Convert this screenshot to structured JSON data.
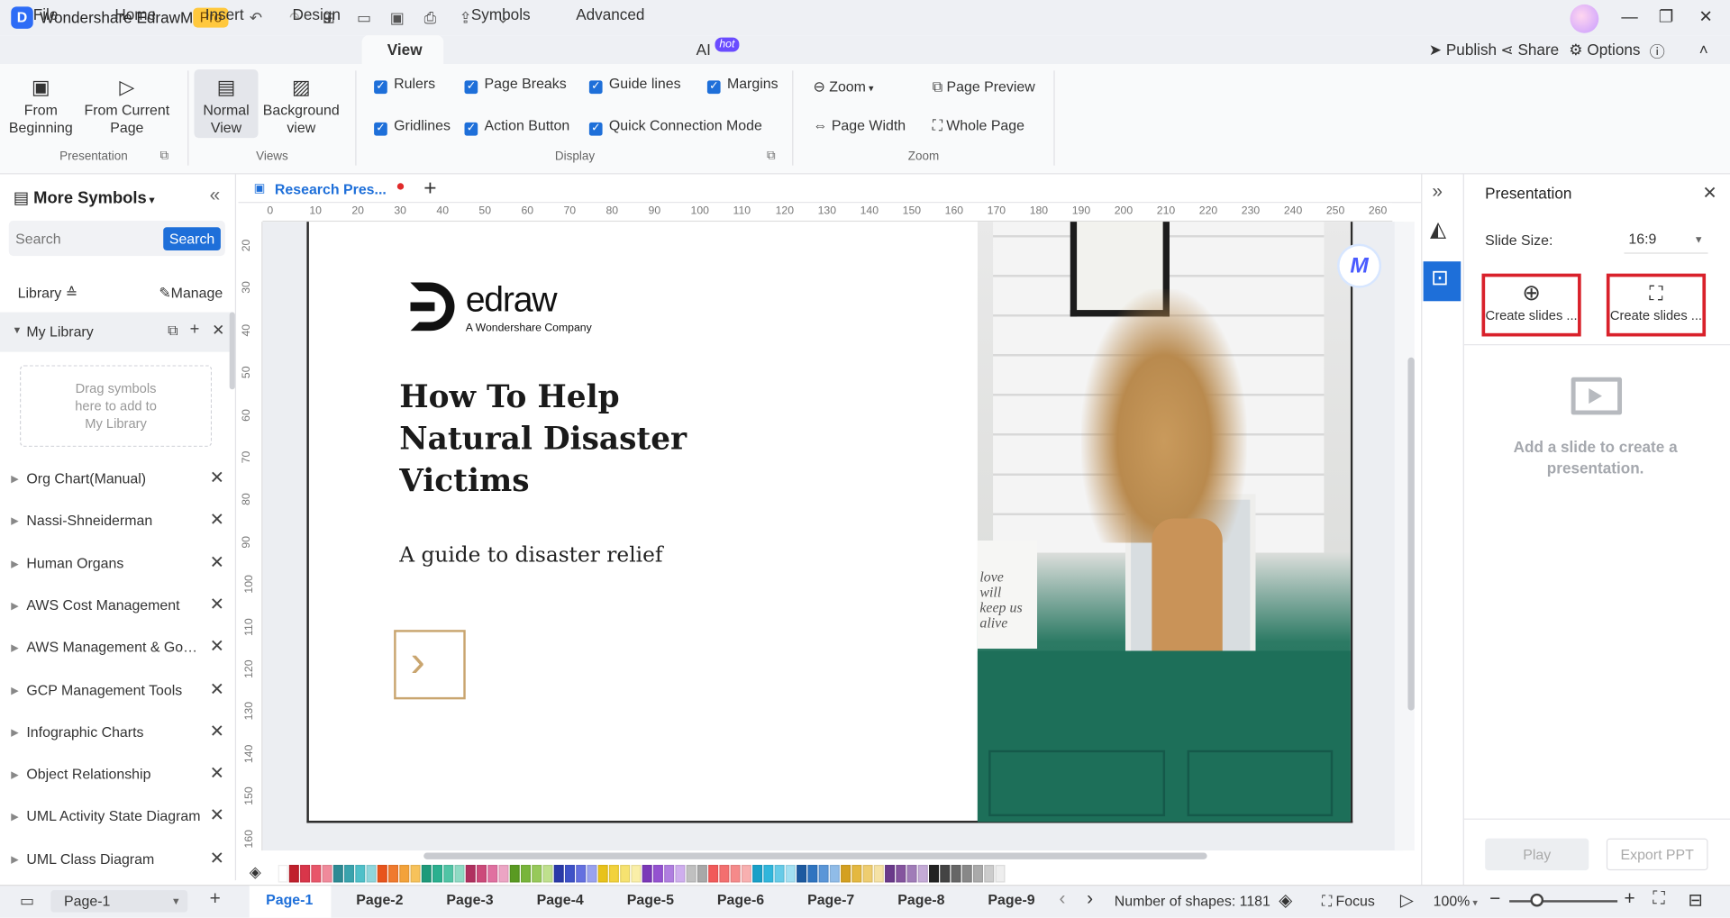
{
  "app": {
    "title": "Wondershare EdrawMax",
    "badge": "Pro"
  },
  "menu": {
    "items": [
      "File",
      "Home",
      "Insert",
      "Design",
      "View",
      "Symbols",
      "Advanced",
      "AI"
    ],
    "ai_badge": "hot",
    "right": {
      "publish": "Publish",
      "share": "Share",
      "options": "Options"
    }
  },
  "ribbon": {
    "presentation": {
      "from_beginning": "From\nBeginning",
      "from_current": "From Current\nPage",
      "group": "Presentation"
    },
    "views": {
      "normal": "Normal\nView",
      "background": "Background\nview",
      "group": "Views"
    },
    "display": {
      "rulers": "Rulers",
      "page_breaks": "Page Breaks",
      "guide_lines": "Guide lines",
      "margins": "Margins",
      "gridlines": "Gridlines",
      "action_button": "Action Button",
      "quick_connection": "Quick Connection Mode",
      "group": "Display"
    },
    "zoom": {
      "zoom": "Zoom",
      "page_preview": "Page Preview",
      "page_width": "Page Width",
      "whole_page": "Whole Page",
      "group": "Zoom"
    }
  },
  "sidebar": {
    "title": "More Symbols",
    "search_placeholder": "Search",
    "search_button": "Search",
    "library": "Library",
    "manage": "Manage",
    "my_library": "My Library",
    "drop_hint": "Drag symbols\nhere to add to\nMy Library",
    "libraries": [
      "Org Chart(Manual)",
      "Nassi-Shneiderman",
      "Human Organs",
      "AWS Cost Management",
      "AWS Management & Gove...",
      "GCP Management Tools",
      "Infographic Charts",
      "Object Relationship",
      "UML Activity State Diagram",
      "UML Class Diagram"
    ]
  },
  "document": {
    "tab": "Research Pres...",
    "ruler_h": [
      "0",
      "10",
      "20",
      "30",
      "40",
      "50",
      "60",
      "70",
      "80",
      "90",
      "100",
      "110",
      "120",
      "130",
      "140",
      "150",
      "160",
      "170",
      "180",
      "190",
      "200",
      "210",
      "220",
      "230",
      "240",
      "250",
      "260"
    ],
    "ruler_v": [
      "20",
      "30",
      "40",
      "50",
      "60",
      "70",
      "80",
      "90",
      "100",
      "110",
      "120",
      "130",
      "140",
      "150",
      "160"
    ]
  },
  "slide": {
    "brand": "edraw",
    "brand_sub": "A Wondershare Company",
    "title_lines": [
      "How To Help",
      "Natural Disaster",
      "Victims"
    ],
    "subtitle": "A guide to disaster relief",
    "frame_text": "love\nwill\nkeep us\nalive"
  },
  "panel": {
    "title": "Presentation",
    "slide_size_label": "Slide Size:",
    "slide_size_value": "16:9",
    "create1": "Create slides ...",
    "create2": "Create slides ...",
    "empty_msg": "Add a slide to create a\npresentation.",
    "play": "Play",
    "export": "Export PPT"
  },
  "status": {
    "page_selector": "Page-1",
    "pages": [
      "Page-1",
      "Page-2",
      "Page-3",
      "Page-4",
      "Page-5",
      "Page-6",
      "Page-7",
      "Page-8",
      "Page-9"
    ],
    "shapes": "Number of shapes: 1181",
    "focus": "Focus",
    "zoom": "100%"
  },
  "colors": {
    "accent": "#1e6fd9",
    "highlight": "#d9212b",
    "slide_arrow": "#c9a56f"
  },
  "palette": [
    "#ffffff",
    "#c0202c",
    "#d9364a",
    "#e8566a",
    "#f08a9b",
    "#2e8a94",
    "#3aa3ad",
    "#4fc0c9",
    "#8fd6dc",
    "#e8541c",
    "#f07a2e",
    "#f3a23a",
    "#f7c25a",
    "#1f9a7a",
    "#2bb08f",
    "#50c4a5",
    "#8fdac4",
    "#b0305f",
    "#cc4a7a",
    "#e070a0",
    "#eca5c4",
    "#5a9a22",
    "#78b53a",
    "#97c95a",
    "#bfe08d",
    "#2a3aa8",
    "#3e52c8",
    "#6470e0",
    "#9aa2ee",
    "#e8c21a",
    "#f2d23c",
    "#f6e270",
    "#faefa8",
    "#7a38b8",
    "#9452d0",
    "#b07ee0",
    "#cfaeee",
    "#c0c0c0",
    "#a8a8a8",
    "#f15a5a",
    "#f36f6f",
    "#f58a8a",
    "#f8b0b0",
    "#18a0c8",
    "#30b6dc",
    "#66cbe8",
    "#a3e0f2",
    "#1d5aa0",
    "#2f74c0",
    "#5a96d8",
    "#90bce8",
    "#d4a020",
    "#e4b840",
    "#eecd70",
    "#f5e2a5",
    "#6a3a8a",
    "#84549e",
    "#a07cb8",
    "#c4aad6",
    "#222222",
    "#444444",
    "#666666",
    "#888888",
    "#aaaaaa",
    "#cccccc",
    "#eeeeee"
  ]
}
